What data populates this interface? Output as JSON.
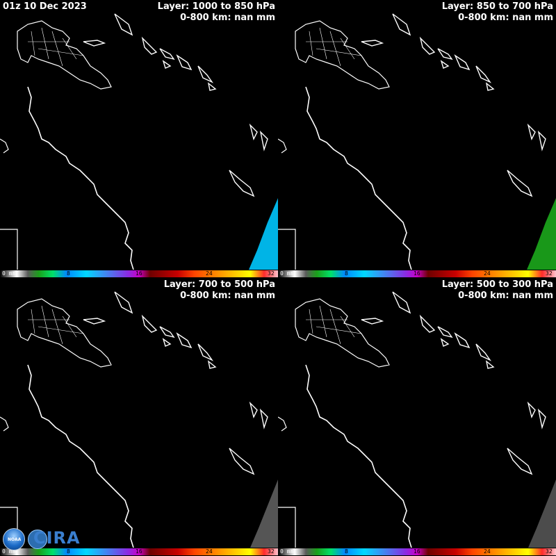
{
  "timestamp": "01z 10 Dec 2023",
  "panels": [
    {
      "layer": "Layer: 1000 to 850 hPa",
      "range": "0-800 km: nan mm",
      "blob_color": "#00c8ff"
    },
    {
      "layer": "Layer: 850 to 700 hPa",
      "range": "0-800 km: nan mm",
      "blob_color": "#1ca81c"
    },
    {
      "layer": "Layer: 700 to 500 hPa",
      "range": "0-800 km: nan mm",
      "blob_color": "#9a9a9a"
    },
    {
      "layer": "Layer: 500 to 300 hPa",
      "range": "0-800 km: nan mm",
      "blob_color": "#8a8a8a"
    }
  ],
  "colorbar": {
    "ticks": [
      "0 mm",
      "8",
      "16",
      "24",
      "32"
    ]
  },
  "logo": {
    "agency": "NOAA",
    "org": "CIRA"
  },
  "colors": {
    "coast": "#ffffff",
    "background": "#000000"
  }
}
